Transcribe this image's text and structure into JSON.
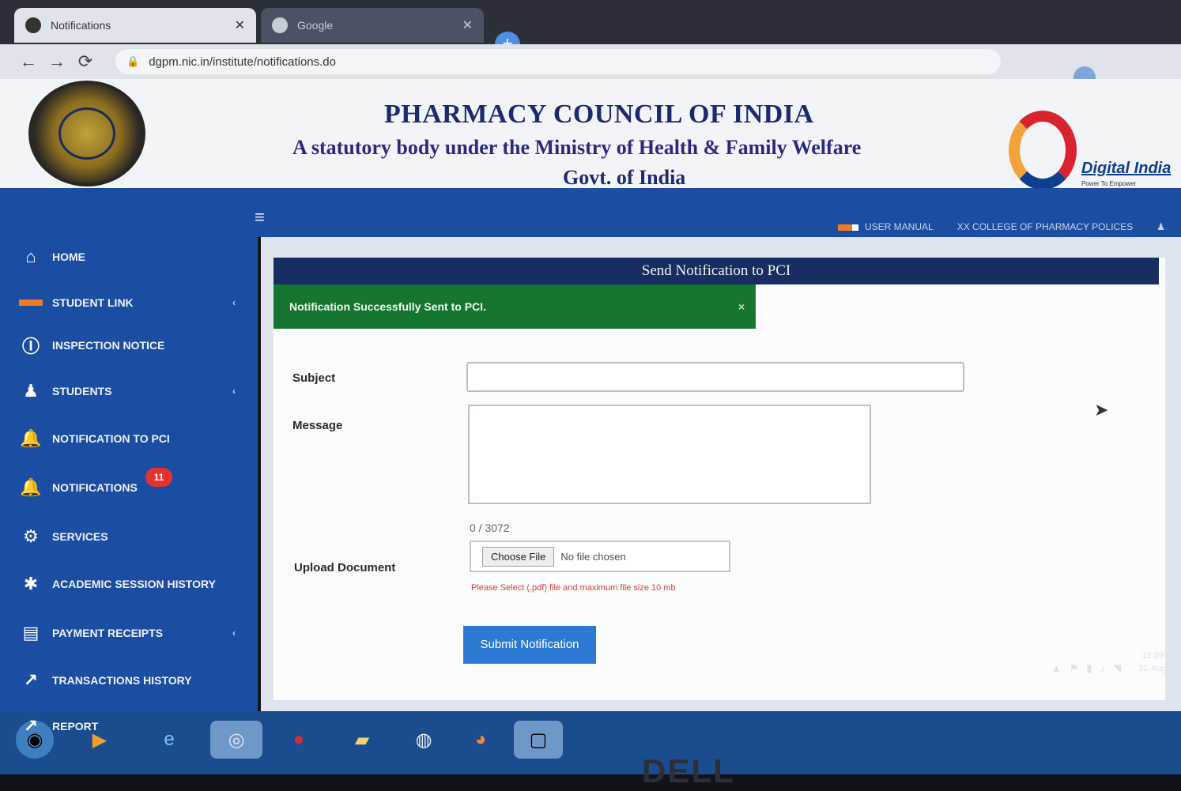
{
  "browser": {
    "tabs": [
      {
        "title": "Notifications",
        "active": true
      },
      {
        "title": "Google",
        "active": false
      }
    ],
    "new_tab": "+",
    "url": "dgpm.nic.in/institute/notifications.do",
    "nav": {
      "back": "←",
      "forward": "→",
      "reload": "⟳",
      "lock": "🔒"
    },
    "tab_close": "✕"
  },
  "banner": {
    "title": "PHARMACY COUNCIL OF INDIA",
    "subtitle": "A statutory body under the Ministry of Health & Family Welfare",
    "govt": "Govt. of India",
    "digital_india": "Digital India",
    "digital_india_sub": "Power To Empower"
  },
  "topbar": {
    "hamburger": "≡",
    "links": [
      "USER MANUAL",
      "XX COLLEGE OF PHARMACY POLICES"
    ],
    "user_icon": "♟"
  },
  "sidebar": {
    "items": [
      {
        "label": "HOME",
        "icon": "home-icon",
        "glyph": "⌂",
        "chevron": false
      },
      {
        "label": "STUDENT LINK",
        "icon": "new-badge-icon",
        "glyph": "▬",
        "chevron": true
      },
      {
        "label": "INSPECTION NOTICE",
        "icon": "info-icon",
        "glyph": "ⓘ",
        "chevron": false
      },
      {
        "label": "STUDENTS",
        "icon": "student-icon",
        "glyph": "♟",
        "chevron": true
      },
      {
        "label": "NOTIFICATION TO PCI",
        "icon": "bell-icon",
        "glyph": "🔔",
        "chevron": false
      },
      {
        "label": "NOTIFICATIONS",
        "icon": "bell-icon",
        "glyph": "🔔",
        "chevron": false
      },
      {
        "label": "SERVICES",
        "icon": "services-icon",
        "glyph": "⚙",
        "chevron": false
      },
      {
        "label": "ACADEMIC SESSION HISTORY",
        "icon": "puzzle-icon",
        "glyph": "✱",
        "chevron": false
      },
      {
        "label": "PAYMENT RECEIPTS",
        "icon": "receipt-icon",
        "glyph": "▤",
        "chevron": true
      },
      {
        "label": "TRANSACTIONS HISTORY",
        "icon": "chart-icon",
        "glyph": "↗",
        "chevron": false
      },
      {
        "label": "REPORT",
        "icon": "chart-icon",
        "glyph": "↗",
        "chevron": false
      }
    ],
    "notifications_badge": "11",
    "chevron_glyph": "‹"
  },
  "form": {
    "heading": "Send Notification to PCI",
    "alert": "Notification Successfully Sent to PCI.",
    "alert_close": "×",
    "subject_label": "Subject",
    "subject_value": "",
    "message_label": "Message",
    "message_value": "",
    "counter": "0 / 3072",
    "upload_label": "Upload Document",
    "choose_file": "Choose File",
    "no_file": "No file chosen",
    "hint": "Please Select (.pdf) file and maximum file size 10 mb",
    "submit": "Submit Notification"
  },
  "taskbar": {
    "apps": [
      "start-orb",
      "media-player",
      "internet-explorer",
      "chrome",
      "app-red",
      "file-explorer",
      "app-circle",
      "firefox",
      "window-thumb"
    ],
    "tray_glyphs": [
      "▲",
      "⚑",
      "▮",
      "♪",
      "◥"
    ],
    "time": "12:39 PM",
    "date": "31-Aug-22"
  },
  "device_brand": "DELL",
  "colors": {
    "sidebar": "#1b4da3",
    "card_header": "#182d62",
    "alert": "#15772f",
    "submit": "#2d7ad4",
    "badge": "#e5322d"
  }
}
